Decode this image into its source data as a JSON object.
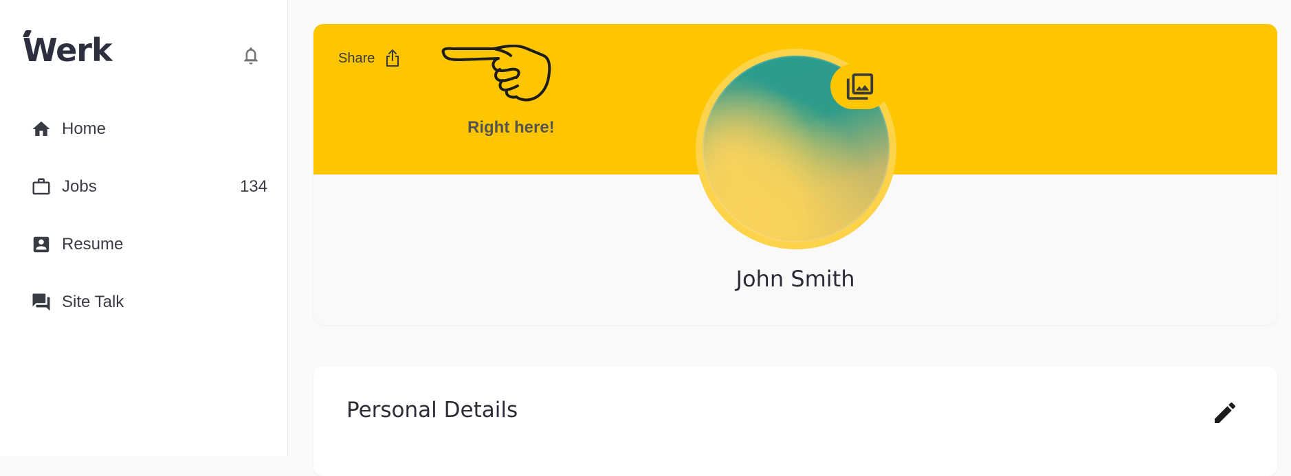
{
  "app": {
    "logo_text": "Werk"
  },
  "sidebar": {
    "items": [
      {
        "label": "Home",
        "icon": "home-icon"
      },
      {
        "label": "Jobs",
        "icon": "briefcase-icon",
        "count": "134"
      },
      {
        "label": "Resume",
        "icon": "resume-icon"
      },
      {
        "label": "Site Talk",
        "icon": "chat-icon"
      }
    ]
  },
  "profile": {
    "share_label": "Share",
    "annotation": "Right here!",
    "name": "John Smith"
  },
  "details": {
    "title": "Personal Details"
  },
  "colors": {
    "banner": "#fdc600",
    "avatar_ring": "#fdd34a",
    "text": "#2b2d36"
  }
}
